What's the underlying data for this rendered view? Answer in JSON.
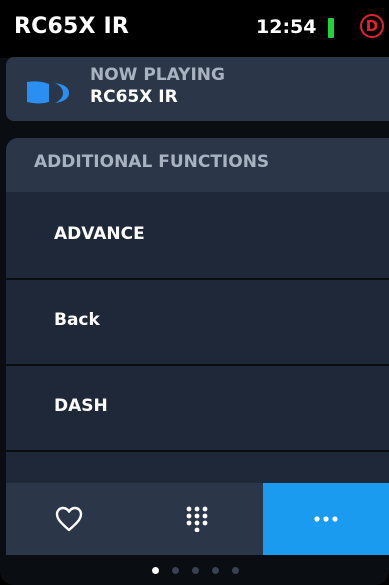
{
  "status_bar": {
    "title": "RC65X IR",
    "time": "12:54",
    "profile_initial": "D",
    "battery_color": "#21d43b",
    "profile_color": "#e5202e"
  },
  "now_playing": {
    "label": "NOW PLAYING",
    "source": "RC65X IR",
    "logo_icon": "directv-logo-icon"
  },
  "functions": {
    "header": "ADDITIONAL FUNCTIONS",
    "items": [
      {
        "label": "ADVANCE"
      },
      {
        "label": "Back"
      },
      {
        "label": "DASH"
      }
    ]
  },
  "bottom_nav": {
    "items": [
      {
        "icon": "heart-icon",
        "active": false
      },
      {
        "icon": "keypad-icon",
        "active": false
      },
      {
        "icon": "more-icon",
        "active": true
      }
    ],
    "active_color": "#1a9bf0"
  },
  "page_indicator": {
    "total": 5,
    "active": 1
  },
  "colors": {
    "panel": "#2b3748",
    "list_bg": "#1f2838",
    "muted_text": "#a8b2c0"
  }
}
